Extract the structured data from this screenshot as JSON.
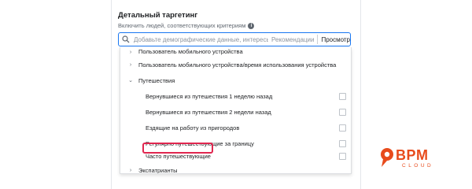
{
  "targeting": {
    "title": "Детальный таргетинг",
    "subtitle": "Включить людей, соответствующих критериям",
    "search": {
      "placeholder": "Добавьте демографические данные, интересы и",
      "recommendations_label": "Рекомендации",
      "browse_label": "Просмотр"
    },
    "list": {
      "items": [
        {
          "label": "Пользователь мобильного устройства",
          "expanded": false,
          "level": 0
        },
        {
          "label": "Пользователь мобильного устройства/время использования устройства",
          "expanded": false,
          "level": 0
        },
        {
          "label": "Путешествия",
          "expanded": true,
          "level": 0
        },
        {
          "label": "Вернувшиеся из путешествия 1 неделю назад",
          "checked": false,
          "level": 1
        },
        {
          "label": "Вернувшиеся из путешествия 2 недели назад",
          "checked": false,
          "level": 1
        },
        {
          "label": "Ездящие на работу из пригородов",
          "checked": false,
          "level": 1
        },
        {
          "label": "Регулярно путешествующие за границу",
          "checked": false,
          "level": 1
        },
        {
          "label": "Часто путешествующие",
          "checked": false,
          "level": 1,
          "highlighted": true
        },
        {
          "label": "Экспатрианты",
          "expanded": false,
          "level": 0
        }
      ]
    }
  },
  "logo": {
    "name": "BPM",
    "sub": "CLOUD"
  },
  "colors": {
    "accent": "#1877f2",
    "highlight": "#e0264f",
    "logo": "#e84b1c"
  }
}
